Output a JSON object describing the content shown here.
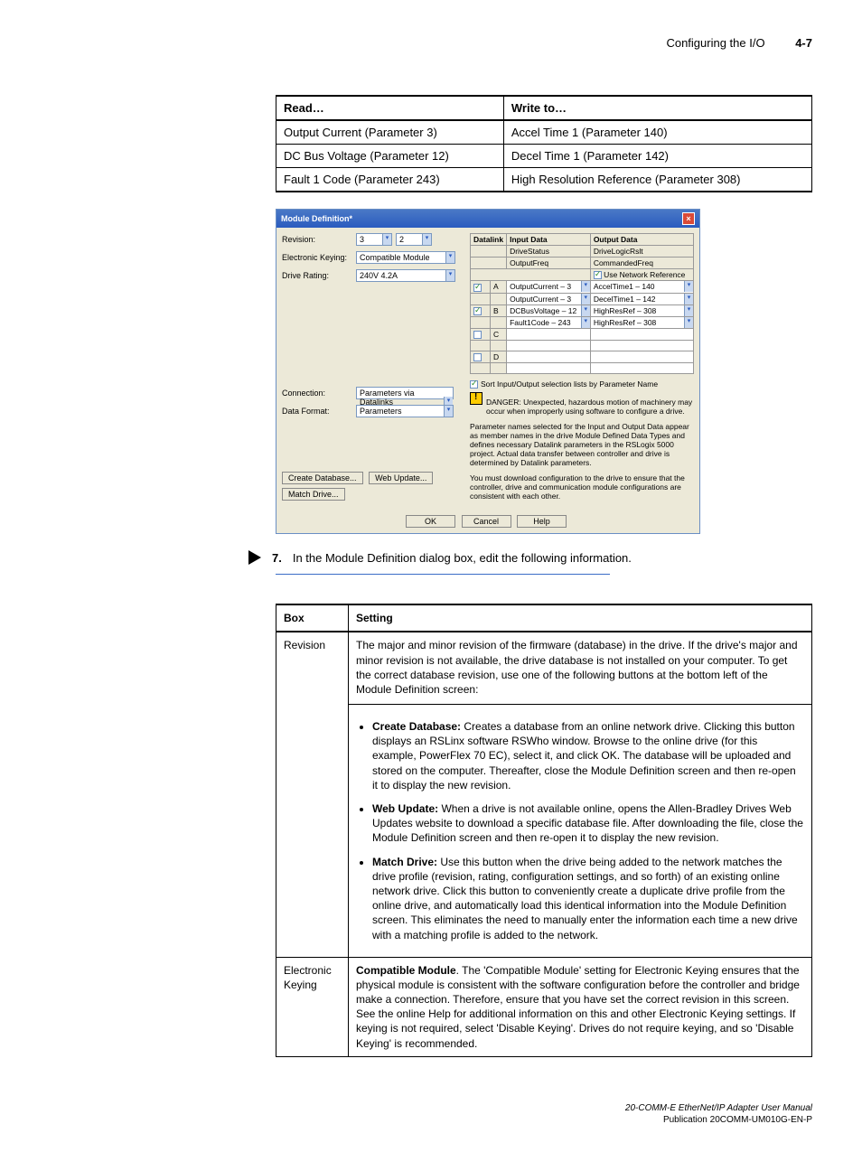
{
  "header": {
    "title": "Configuring the I/O",
    "chapter": "4-7"
  },
  "table1": {
    "headers": [
      "Read…",
      "Write to…"
    ],
    "rows": [
      [
        "Output Current (Parameter 3)",
        "Accel Time 1 (Parameter 140)"
      ],
      [
        "DC Bus Voltage (Parameter 12)",
        "Decel Time 1 (Parameter 142)"
      ],
      [
        "Fault 1 Code (Parameter 243)",
        "High Resolution Reference (Parameter 308)"
      ]
    ]
  },
  "dialog": {
    "title": "Module Definition*",
    "labels": {
      "revision": "Revision:",
      "keying": "Electronic Keying:",
      "rating": "Drive Rating:",
      "connection": "Connection:",
      "format": "Data Format:"
    },
    "values": {
      "rev_major": "3",
      "rev_minor": "2",
      "keying": "Compatible Module",
      "rating": "240V   4.2A",
      "connection": "Parameters via Datalinks",
      "format": "Parameters"
    },
    "buttons": {
      "create_db": "Create Database...",
      "web_update": "Web Update...",
      "match_drive": "Match Drive...",
      "ok": "OK",
      "cancel": "Cancel",
      "help": "Help"
    },
    "grid": {
      "headers": [
        "Datalink",
        "Input Data",
        "Output Data"
      ],
      "fixed_rows": [
        [
          "",
          "DriveStatus",
          "DriveLogicRslt"
        ],
        [
          "",
          "OutputFreq",
          "CommandedFreq"
        ]
      ],
      "use_network_ref": "Use Network Reference",
      "rows": [
        {
          "chk": true,
          "dl": "A",
          "in": "OutputCurrent – 3",
          "out": "AccelTime1 – 140"
        },
        {
          "chk": false,
          "dl": "",
          "in": "OutputCurrent – 3",
          "out": "DecelTime1 – 142"
        },
        {
          "chk": true,
          "dl": "B",
          "in": "DCBusVoltage – 12",
          "out": "HighResRef – 308"
        },
        {
          "chk": false,
          "dl": "",
          "in": "Fault1Code – 243",
          "out": "HighResRef – 308"
        },
        {
          "chk": false,
          "dl": "C",
          "in": "",
          "out": ""
        },
        {
          "chk": false,
          "dl": "",
          "in": "",
          "out": ""
        },
        {
          "chk": false,
          "dl": "D",
          "in": "",
          "out": ""
        },
        {
          "chk": false,
          "dl": "",
          "in": "",
          "out": ""
        }
      ],
      "sort_label": "Sort Input/Output selection lists by Parameter Name"
    },
    "warn1": "DANGER: Unexpected, hazardous motion of machinery may occur when improperly using software to configure a drive.",
    "note1": "Parameter names selected for the Input and Output Data appear as member names in the drive Module Defined Data Types and defines necessary Datalink parameters in the RSLogix 5000 project. Actual data transfer between controller and drive is determined by Datalink parameters.",
    "note2": "You must download configuration to the drive to ensure that the controller, drive and communication module configurations are consistent with each other."
  },
  "step": {
    "num": "7.",
    "text": "In the Module Definition dialog box, edit the following information."
  },
  "settings": {
    "headers": [
      "Box",
      "Setting"
    ],
    "rows": [
      {
        "box": "Revision",
        "intro": "The major and minor revision of the firmware (database) in the drive. If the drive's major and minor revision is not available, the drive database is not installed on your computer. To get the correct database revision, use one of the following buttons at the bottom left of the Module Definition screen:",
        "bullets": [
          {
            "bold": "Create Database:",
            "text": " Creates a database from an online network drive. Clicking this button displays an RSLinx software RSWho window. Browse to the online drive (for this example, PowerFlex 70 EC), select it, and click OK. The database will be uploaded and stored on the computer. Thereafter, close the Module Definition screen and then re-open it to display the new revision."
          },
          {
            "bold": "Web Update:",
            "text": " When a drive is not available online, opens the Allen-Bradley Drives Web Updates website to download a specific database file. After downloading the file, close the Module Definition screen and then re-open it to display the new revision."
          },
          {
            "bold": "Match Drive:",
            "text": " Use this button when the drive being added to the network matches the drive profile (revision, rating, configuration settings, and so forth) of an existing online network drive. Click this button to conveniently create a duplicate drive profile from the online drive, and automatically load this identical information into the Module Definition screen. This eliminates the need to manually enter the information each time a new drive with a matching profile is added to the network."
          }
        ]
      },
      {
        "box": "Electronic Keying",
        "text_bold": "Compatible Module",
        "text": ". The 'Compatible Module' setting for Electronic Keying ensures that the physical module is consistent with the software configuration before the controller and bridge make a connection. Therefore, ensure that you have set the correct revision in this screen. See the online Help for additional information on this and other Electronic Keying settings. If keying is not required, select 'Disable Keying'. Drives do not require keying, and so 'Disable Keying' is recommended."
      }
    ]
  },
  "footer": {
    "line1": "20-COMM-E EtherNet/IP Adapter User Manual",
    "line2": "Publication 20COMM-UM010G-EN-P"
  }
}
